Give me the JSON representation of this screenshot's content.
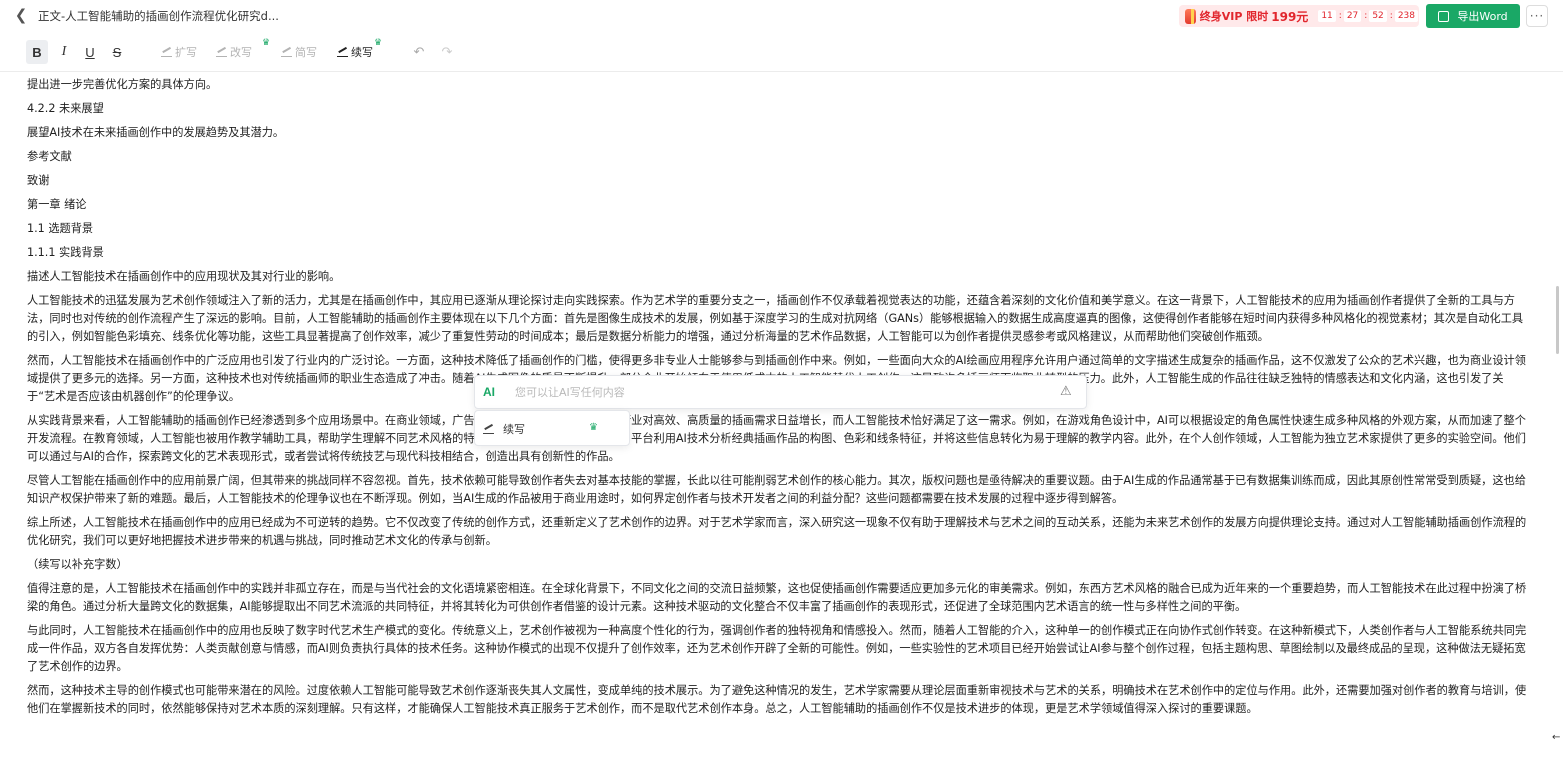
{
  "header": {
    "back_icon": "chevron-left-icon",
    "title": "正文-人工智能辅助的插画创作流程优化研究d...",
    "vip": {
      "label": "终身VIP 限时",
      "price": "199元",
      "timer": [
        "11",
        "27",
        "52",
        "238"
      ]
    },
    "export_label": "导出Word",
    "more_label": "···"
  },
  "toolbar": {
    "bold": "B",
    "italic": "I",
    "underline": "U",
    "strike": "S",
    "tools": [
      {
        "label": "扩写",
        "active": false,
        "vip": false
      },
      {
        "label": "改写",
        "active": false,
        "vip": true
      },
      {
        "label": "简写",
        "active": false,
        "vip": false
      },
      {
        "label": "续写",
        "active": true,
        "vip": true
      }
    ],
    "undo": "↶",
    "redo": "↷"
  },
  "ai_popup": {
    "logo": "AI",
    "placeholder": "您可以让AI写任何内容",
    "menu_item": "续写",
    "crown": "♛"
  },
  "content": {
    "paragraphs": [
      "提出进一步完善优化方案的具体方向。",
      "4.2.2 未来展望",
      "展望AI技术在未来插画创作中的发展趋势及其潜力。",
      "参考文献",
      "致谢",
      "第一章 绪论",
      "1.1 选题背景",
      "1.1.1 实践背景",
      "描述人工智能技术在插画创作中的应用现状及其对行业的影响。",
      "人工智能技术的迅猛发展为艺术创作领域注入了新的活力，尤其是在插画创作中，其应用已逐渐从理论探讨走向实践探索。作为艺术学的重要分支之一，插画创作不仅承载着视觉表达的功能，还蕴含着深刻的文化价值和美学意义。在这一背景下，人工智能技术的应用为插画创作者提供了全新的工具与方法，同时也对传统的创作流程产生了深远的影响。目前，人工智能辅助的插画创作主要体现在以下几个方面：首先是图像生成技术的发展，例如基于深度学习的生成对抗网络（GANs）能够根据输入的数据生成高度逼真的图像，这使得创作者能够在短时间内获得多种风格化的视觉素材；其次是自动化工具的引入，例如智能色彩填充、线条优化等功能，这些工具显著提高了创作效率，减少了重复性劳动的时间成本；最后是数据分析能力的增强，通过分析海量的艺术作品数据，人工智能可以为创作者提供灵感参考或风格建议，从而帮助他们突破创作瓶颈。",
      "然而，人工智能技术在插画创作中的广泛应用也引发了行业内的广泛讨论。一方面，这种技术降低了插画创作的门槛，使得更多非专业人士能够参与到插画创作中来。例如，一些面向大众的AI绘画应用程序允许用户通过简单的文字描述生成复杂的插画作品，这不仅激发了公众的艺术兴趣，也为商业设计领域提供了更多元的选择。另一方面，这种技术也对传统插画师的职业生态造成了冲击。随着AI生成图像的质量不断提升，部分企业开始倾向于使用低成本的人工智能替代人工创作，这导致许多插画师面临职业转型的压力。此外，人工智能生成的作品往往缺乏独特的情感表达和文化内涵，这也引发了关于“艺术是否应该由机器创作”的伦理争议。",
      "从实践背景来看，人工智能辅助的插画创作已经渗透到多个应用场景中。在商业领域，广告设计、游戏美术和动画制作等行业对高效、高质量的插画需求日益增长，而人工智能技术恰好满足了这一需求。例如，在游戏角色设计中，AI可以根据设定的角色属性快速生成多种风格的外观方案，从而加速了整个开发流程。在教育领域，人工智能也被用作教学辅助工具，帮助学生理解不同艺术风格的特点和技法。例如，某些在线学习平台利用AI技术分析经典插画作品的构图、色彩和线条特征，并将这些信息转化为易于理解的教学内容。此外，在个人创作领域，人工智能为独立艺术家提供了更多的实验空间。他们可以通过与AI的合作，探索跨文化的艺术表现形式，或者尝试将传统技艺与现代科技相结合，创造出具有创新性的作品。",
      "尽管人工智能在插画创作中的应用前景广阔，但其带来的挑战同样不容忽视。首先，技术依赖可能导致创作者失去对基本技能的掌握，长此以往可能削弱艺术创作的核心能力。其次，版权问题也是亟待解决的重要议题。由于AI生成的作品通常基于已有数据集训练而成，因此其原创性常常受到质疑，这也给知识产权保护带来了新的难题。最后，人工智能技术的伦理争议也在不断浮现。例如，当AI生成的作品被用于商业用途时，如何界定创作者与技术开发者之间的利益分配？这些问题都需要在技术发展的过程中逐步得到解答。",
      "综上所述，人工智能技术在插画创作中的应用已经成为不可逆转的趋势。它不仅改变了传统的创作方式，还重新定义了艺术创作的边界。对于艺术学家而言，深入研究这一现象不仅有助于理解技术与艺术之间的互动关系，还能为未来艺术创作的发展方向提供理论支持。通过对人工智能辅助插画创作流程的优化研究，我们可以更好地把握技术进步带来的机遇与挑战，同时推动艺术文化的传承与创新。",
      "（续写以补充字数）",
      "值得注意的是，人工智能技术在插画创作中的实践并非孤立存在，而是与当代社会的文化语境紧密相连。在全球化背景下，不同文化之间的交流日益频繁，这也促使插画创作需要适应更加多元化的审美需求。例如，东西方艺术风格的融合已成为近年来的一个重要趋势，而人工智能技术在此过程中扮演了桥梁的角色。通过分析大量跨文化的数据集，AI能够提取出不同艺术流派的共同特征，并将其转化为可供创作者借鉴的设计元素。这种技术驱动的文化整合不仅丰富了插画创作的表现形式，还促进了全球范围内艺术语言的统一性与多样性之间的平衡。",
      "与此同时，人工智能技术在插画创作中的应用也反映了数字时代艺术生产模式的变化。传统意义上，艺术创作被视为一种高度个性化的行为，强调创作者的独特视角和情感投入。然而，随着人工智能的介入，这种单一的创作模式正在向协作式创作转变。在这种新模式下，人类创作者与人工智能系统共同完成一件作品，双方各自发挥优势：人类贡献创意与情感，而AI则负责执行具体的技术任务。这种协作模式的出现不仅提升了创作效率，还为艺术创作开辟了全新的可能性。例如，一些实验性的艺术项目已经开始尝试让AI参与整个创作过程，包括主题构思、草图绘制以及最终成品的呈现，这种做法无疑拓宽了艺术创作的边界。",
      "然而，这种技术主导的创作模式也可能带来潜在的风险。过度依赖人工智能可能导致艺术创作逐渐丧失其人文属性，变成单纯的技术展示。为了避免这种情况的发生，艺术学家需要从理论层面重新审视技术与艺术的关系，明确技术在艺术创作中的定位与作用。此外，还需要加强对创作者的教育与培训，使他们在掌握新技术的同时，依然能够保持对艺术本质的深刻理解。只有这样，才能确保人工智能技术真正服务于艺术创作，而不是取代艺术创作本身。总之，人工智能辅助的插画创作不仅是技术进步的体现，更是艺术学领域值得深入探讨的重要课题。"
    ]
  }
}
